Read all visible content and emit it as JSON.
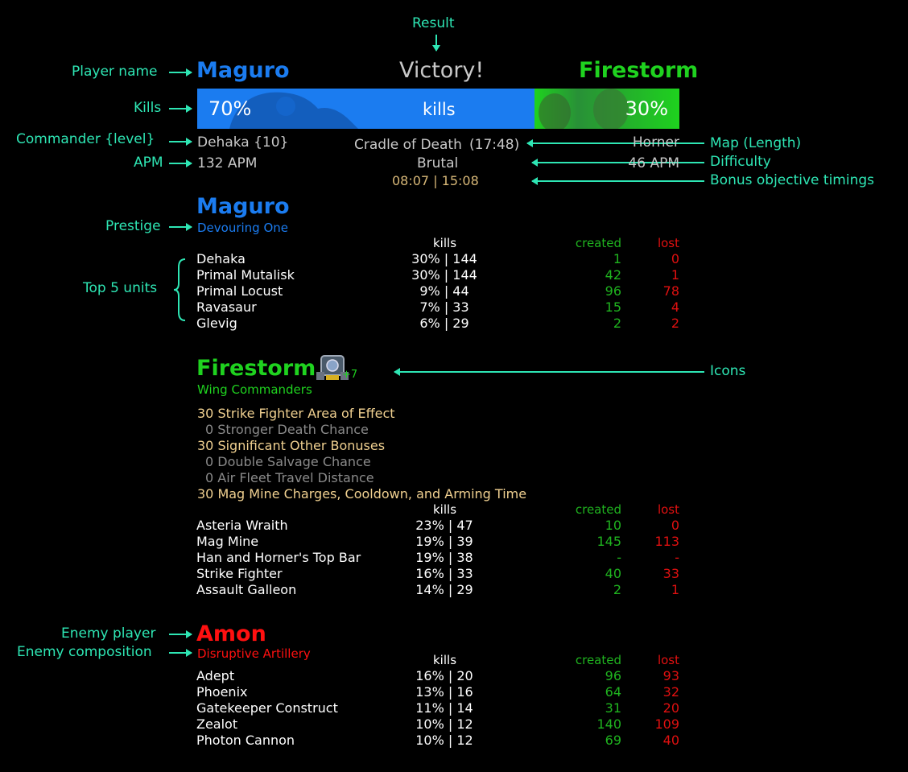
{
  "header": {
    "result": "Victory!",
    "player1_name": "Maguro",
    "player2_name": "Firestorm",
    "kills_p1": "70%",
    "kills_label": "kills",
    "kills_p2": "30%",
    "kills_p1_fraction": 0.7,
    "p1_commander": "Dehaka {10}",
    "p2_commander": "Horner",
    "p1_apm": "132 APM",
    "p2_apm": "46 APM",
    "map": "Cradle of Death",
    "length": "(17:48)",
    "difficulty": "Brutal",
    "bonus_timings": "08:07 | 15:08"
  },
  "annotations": {
    "result": "Result",
    "player_name": "Player name",
    "kills": "Kills",
    "commander_level": "Commander {level}",
    "apm": "APM",
    "prestige": "Prestige",
    "top5": "Top 5 units",
    "map_length": "Map (Length)",
    "difficulty": "Difficulty",
    "bonus": "Bonus objective timings",
    "icons": "Icons",
    "enemy_player": "Enemy player",
    "enemy_comp": "Enemy composition"
  },
  "columns": {
    "kills": "kills",
    "created": "created",
    "lost": "lost"
  },
  "player1": {
    "name": "Maguro",
    "prestige": "Devouring One",
    "units": [
      {
        "name": "Dehaka",
        "kills": "30% | 144",
        "created": "1",
        "lost": "0"
      },
      {
        "name": "Primal Mutalisk",
        "kills": "30% | 144",
        "created": "42",
        "lost": "1"
      },
      {
        "name": "Primal Locust",
        "kills": "9% | 44",
        "created": "96",
        "lost": "78"
      },
      {
        "name": "Ravasaur",
        "kills": "7% | 33",
        "created": "15",
        "lost": "4"
      },
      {
        "name": "Glevig",
        "kills": "6% | 29",
        "created": "2",
        "lost": "2"
      }
    ]
  },
  "player2": {
    "name": "Firestorm",
    "prestige": "Wing Commanders",
    "icon_badge": "+7",
    "icon": "mag-mine-icon",
    "masteries": [
      {
        "text": "30 Strike Fighter Area of Effect",
        "active": true
      },
      {
        "text": "0 Stronger Death Chance",
        "active": false
      },
      {
        "text": "30 Significant Other Bonuses",
        "active": true
      },
      {
        "text": "0 Double Salvage Chance",
        "active": false
      },
      {
        "text": "0 Air Fleet Travel Distance",
        "active": false
      },
      {
        "text": "30 Mag Mine Charges, Cooldown, and Arming Time",
        "active": true
      }
    ],
    "units": [
      {
        "name": "Asteria Wraith",
        "kills": "23% | 47",
        "created": "10",
        "lost": "0"
      },
      {
        "name": "Mag Mine",
        "kills": "19% | 39",
        "created": "145",
        "lost": "113"
      },
      {
        "name": "Han and Horner's Top Bar",
        "kills": "19% | 38",
        "created": "-",
        "lost": "-"
      },
      {
        "name": "Strike Fighter",
        "kills": "16% | 33",
        "created": "40",
        "lost": "33"
      },
      {
        "name": "Assault Galleon",
        "kills": "14% | 29",
        "created": "2",
        "lost": "1"
      }
    ]
  },
  "enemy": {
    "name": "Amon",
    "composition": "Disruptive Artillery",
    "units": [
      {
        "name": "Adept",
        "kills": "16% | 20",
        "created": "96",
        "lost": "93"
      },
      {
        "name": "Phoenix",
        "kills": "13% | 16",
        "created": "64",
        "lost": "32"
      },
      {
        "name": "Gatekeeper Construct",
        "kills": "11% | 14",
        "created": "31",
        "lost": "20"
      },
      {
        "name": "Zealot",
        "kills": "10% | 12",
        "created": "140",
        "lost": "109"
      },
      {
        "name": "Photon Cannon",
        "kills": "10% | 12",
        "created": "69",
        "lost": "40"
      }
    ]
  },
  "colors": {
    "player1": "#1b7cf0",
    "player2": "#1fd21f",
    "enemy": "#ff1010",
    "annotation": "#2ee6b4",
    "created": "#1fb31f",
    "lost": "#e01010",
    "mastery": "#f0d090",
    "bonus": "#d8b878"
  }
}
